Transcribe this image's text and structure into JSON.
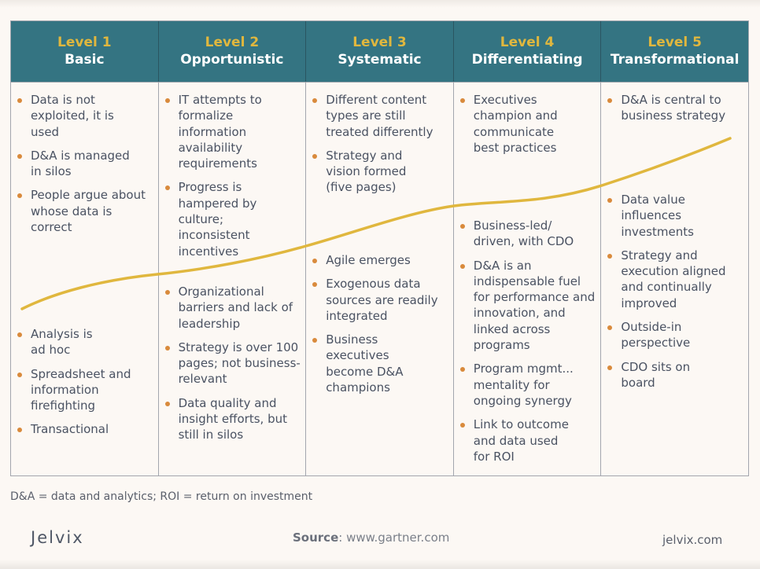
{
  "levels": [
    {
      "level": "Level 1",
      "name": "Basic",
      "top_items": [
        "Data is not exploited, it is used",
        "D&A is managed in silos",
        "People argue about whose data is correct"
      ],
      "bottom_items": [
        "Analysis is ad hoc",
        "Spreadsheet and information firefighting",
        "Transactional"
      ]
    },
    {
      "level": "Level 2",
      "name": "Opportunistic",
      "top_items": [
        "IT attempts to formalize information availability requirements",
        "Progress is hampered by culture; inconsistent incentives"
      ],
      "bottom_items": [
        "Organizational barriers and lack of leadership",
        "Strategy is over 100 pages; not business-relevant",
        "Data quality and insight efforts, but still in silos"
      ]
    },
    {
      "level": "Level 3",
      "name": "Systematic",
      "top_items": [
        "Different content types are still treated differently",
        "Strategy and vision formed (five pages)"
      ],
      "bottom_items": [
        "Agile emerges",
        "Exogenous data sources are readily integrated",
        "Business executives become D&A champions"
      ]
    },
    {
      "level": "Level 4",
      "name": "Differentiating",
      "top_items": [
        "Executives champion and communicate best practices"
      ],
      "bottom_items": [
        "Business-led/ driven, with CDO",
        "D&A is an indispensable fuel for performance and innovation, and linked across programs",
        "Program mgmt... mentality for ongoing synergy",
        "Link to outcome and data used for ROI"
      ]
    },
    {
      "level": "Level 5",
      "name": "Transformational",
      "top_items": [
        "D&A is central to business strategy"
      ],
      "bottom_items": [
        "Data value influences investments",
        "Strategy and execution aligned and continually improved",
        "Outside-in perspective",
        "CDO sits on board"
      ]
    }
  ],
  "maturity_curve": {
    "description": "Upward maturity trend line from Level 1 to Level 5",
    "color": "#e0b73e"
  },
  "colors": {
    "header_bg": "#347482",
    "level_label": "#e0b73e",
    "bullet": "#d98a3c",
    "text": "#4a5262",
    "background": "#fcf8f4"
  },
  "footnote": "D&A = data and analytics; ROI = return on investment",
  "footer": {
    "logo": "Jelvix",
    "source_label": "Source",
    "source_value": ": www.gartner.com",
    "site": "jelvix.com"
  }
}
